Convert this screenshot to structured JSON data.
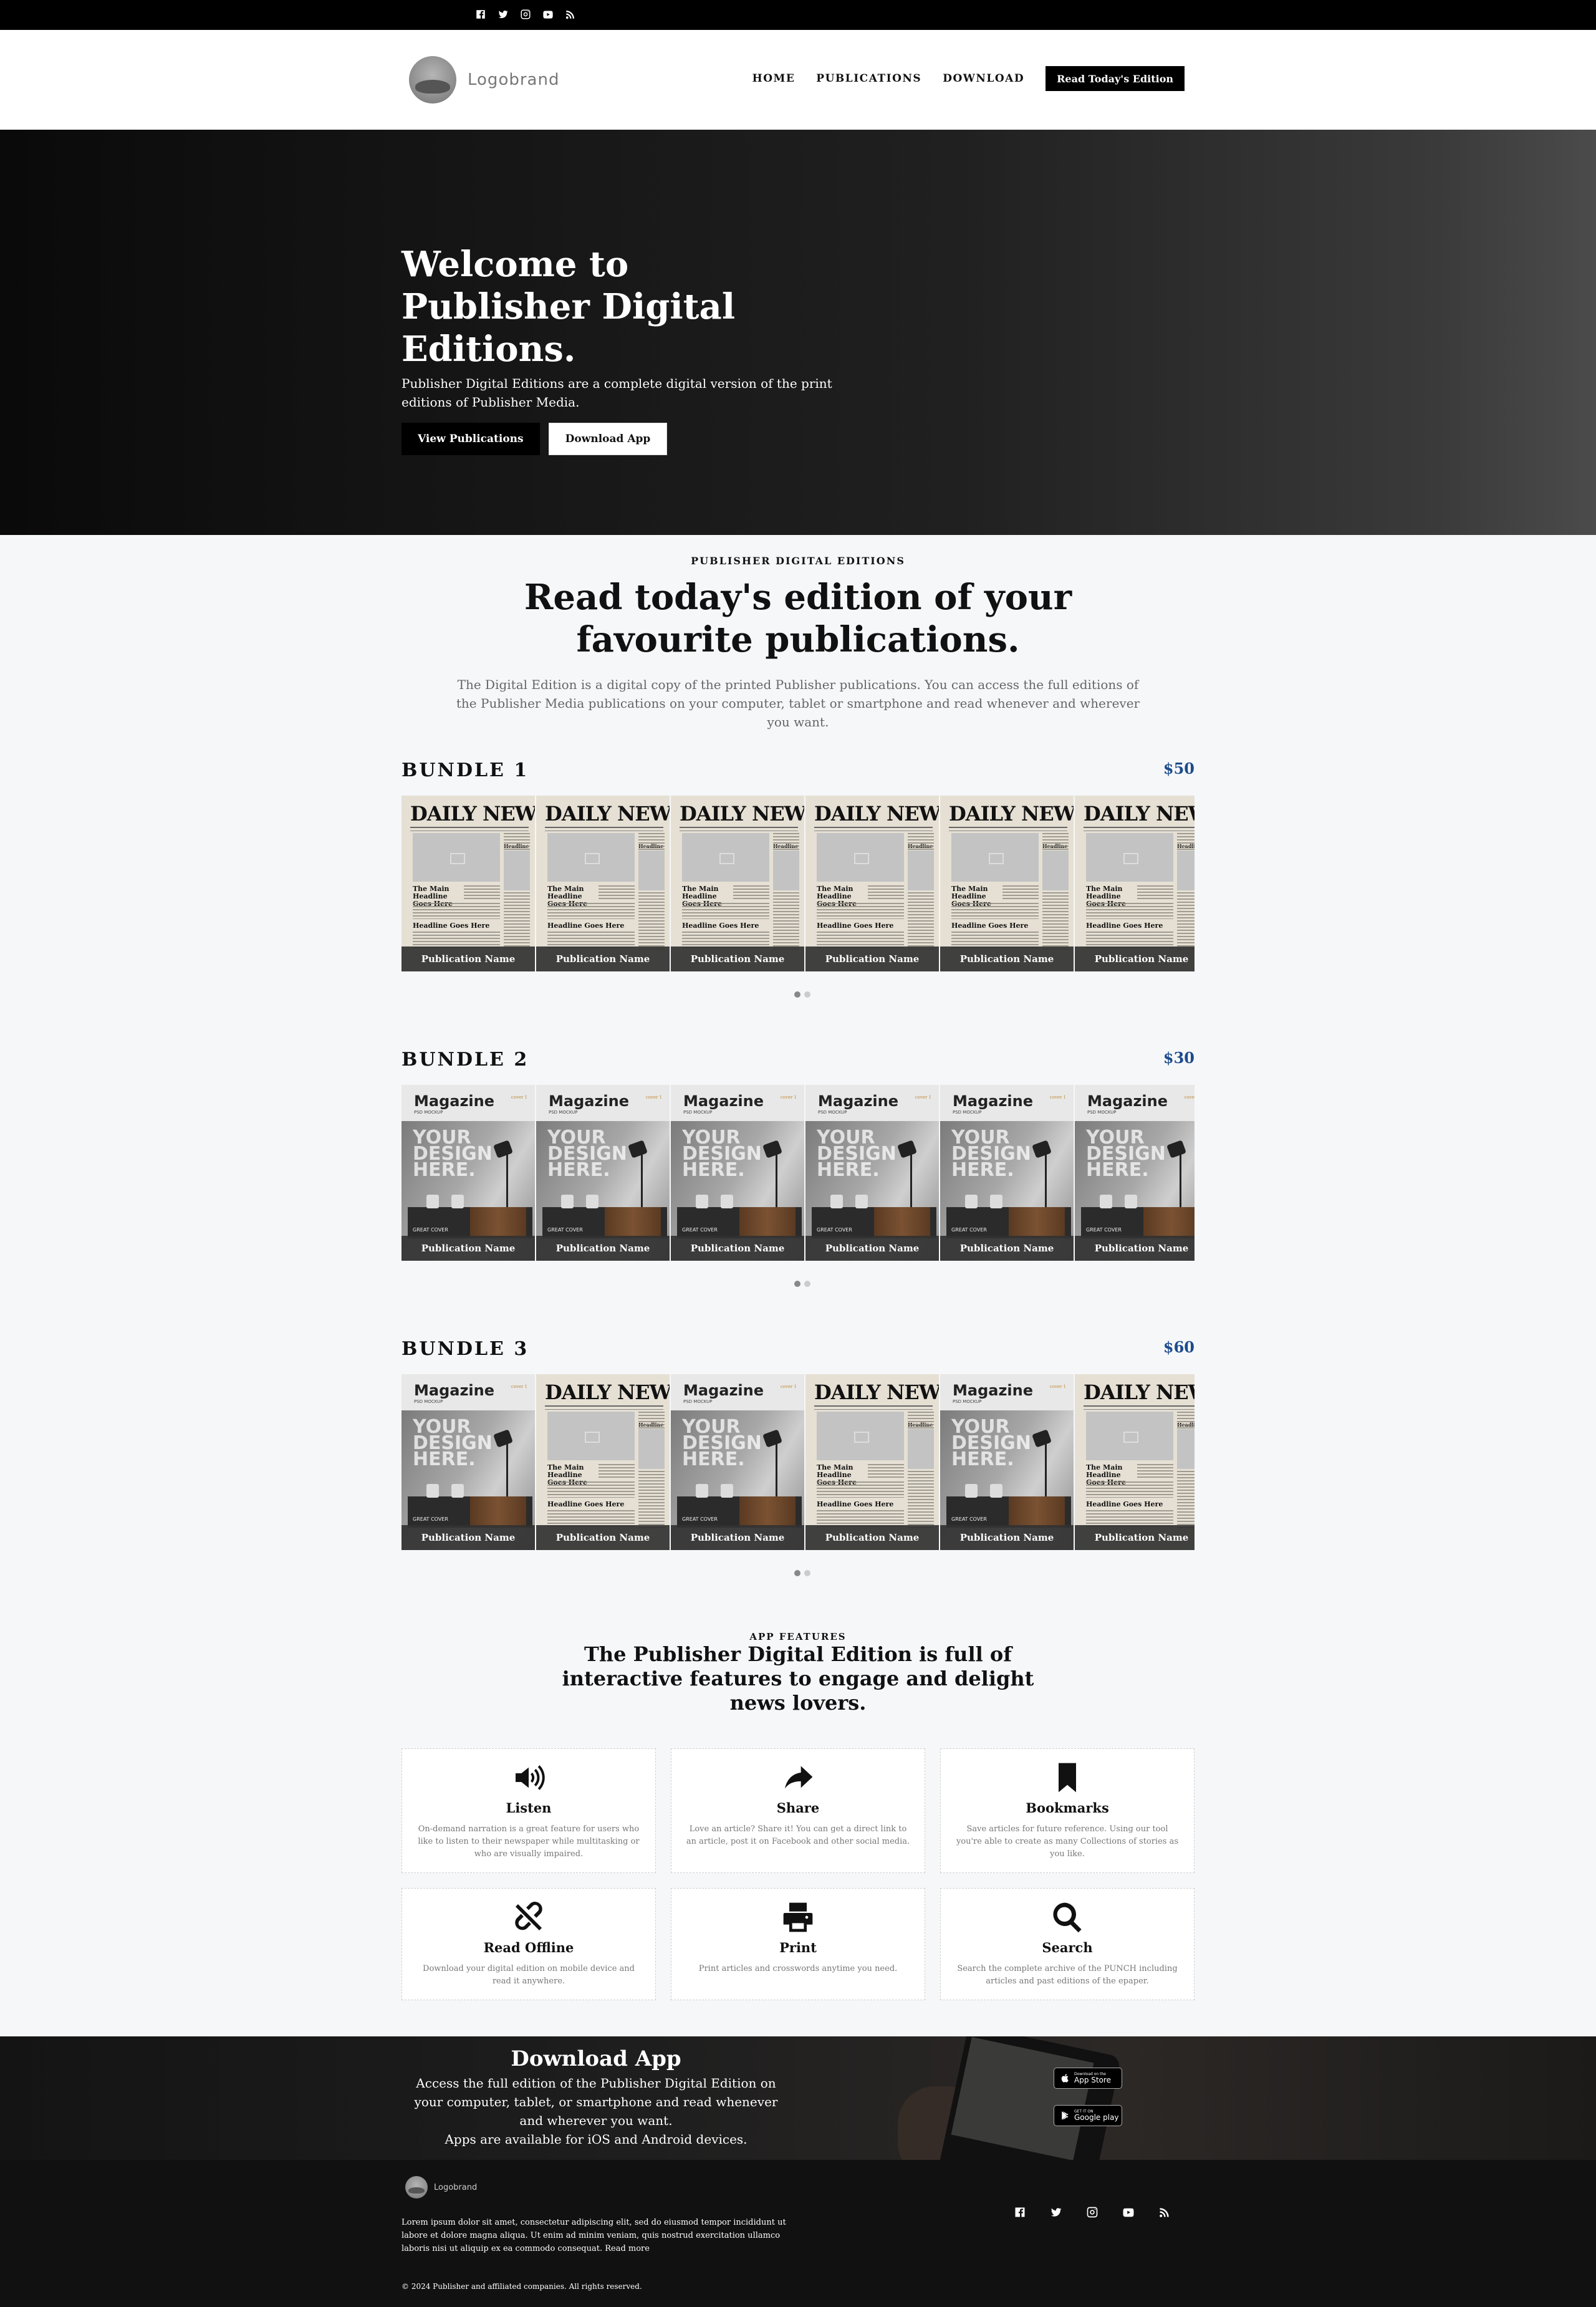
{
  "topbar": {
    "icons": [
      "facebook-icon",
      "twitter-icon",
      "instagram-icon",
      "youtube-icon",
      "rss-icon"
    ]
  },
  "header": {
    "logo_text": "Logobrand",
    "nav": [
      "HOME",
      "PUBLICATIONS",
      "DOWNLOAD"
    ],
    "cta": "Read Today's Edition"
  },
  "hero": {
    "title_line1": "Welcome to",
    "title_line2": "Publisher Digital Editions.",
    "description": "Publisher Digital Editions are a complete digital version of the print editions of Publisher Media.",
    "btn_primary": "View Publications",
    "btn_secondary": "Download App"
  },
  "intro": {
    "eyebrow": "PUBLISHER DIGITAL EDITIONS",
    "title": "Read today's edition of your favourite publications.",
    "description": "The Digital Edition is a digital copy of the printed Publisher publications. You can access the full editions of the Publisher Media publications on your computer, tablet or smartphone and read whenever and wherever you want."
  },
  "cover_text": {
    "news_masthead": "DAILY NEWS",
    "news_headline": "The Main Headline Goes Here",
    "news_headline2": "Headline Goes Here",
    "news_side_headline": "Headline Here",
    "mag_title": "Magazine",
    "mag_sub": "PSD MOCKUP",
    "mag_badge": "cover 1",
    "mag_big": "YOUR DESIGN HERE.",
    "mag_cover": "GREAT COVER"
  },
  "bundles": [
    {
      "name": "BUNDLE 1",
      "price": "$50",
      "items": [
        {
          "type": "news",
          "label": "Publication Name"
        },
        {
          "type": "news",
          "label": "Publication Name"
        },
        {
          "type": "news",
          "label": "Publication Name"
        },
        {
          "type": "news",
          "label": "Publication Name"
        },
        {
          "type": "news",
          "label": "Publication Name"
        },
        {
          "type": "news",
          "label": "Publication Name"
        }
      ]
    },
    {
      "name": "BUNDLE 2",
      "price": "$30",
      "items": [
        {
          "type": "mag",
          "label": "Publication Name"
        },
        {
          "type": "mag",
          "label": "Publication Name"
        },
        {
          "type": "mag",
          "label": "Publication Name"
        },
        {
          "type": "mag",
          "label": "Publication Name"
        },
        {
          "type": "mag",
          "label": "Publication Name"
        },
        {
          "type": "mag",
          "label": "Publication Name"
        }
      ]
    },
    {
      "name": "BUNDLE 3",
      "price": "$60",
      "items": [
        {
          "type": "mag",
          "label": "Publication Name"
        },
        {
          "type": "news",
          "label": "Publication Name"
        },
        {
          "type": "mag",
          "label": "Publication Name"
        },
        {
          "type": "news",
          "label": "Publication Name"
        },
        {
          "type": "mag",
          "label": "Publication Name"
        },
        {
          "type": "news",
          "label": "Publication Name"
        }
      ]
    }
  ],
  "features": {
    "eyebrow": "APP FEATURES",
    "title": "The Publisher Digital Edition is full of interactive features to engage and delight news lovers.",
    "items": [
      {
        "icon": "volume-icon",
        "title": "Listen",
        "text": "On-demand narration is a great feature for users who like to listen to their newspaper while multitasking or who are visually impaired."
      },
      {
        "icon": "share-icon",
        "title": "Share",
        "text": "Love an article? Share it! You can get a direct link to an article, post it on Facebook and other social media."
      },
      {
        "icon": "bookmark-icon",
        "title": "Bookmarks",
        "text": "Save articles for future reference. Using our tool you're able to create as many Collections of stories as you like."
      },
      {
        "icon": "unlink-icon",
        "title": "Read Offline",
        "text": "Download your digital edition on mobile device and read it anywhere."
      },
      {
        "icon": "print-icon",
        "title": "Print",
        "text": "Print articles and crosswords anytime you need."
      },
      {
        "icon": "search-icon",
        "title": "Search",
        "text": "Search the complete archive of the PUNCH including articles and past editions of the epaper."
      }
    ]
  },
  "download": {
    "title": "Download App",
    "text1": "Access the full edition of the Publisher Digital Edition on your computer, tablet, or smartphone and read whenever and wherever you want.",
    "text2": "Apps are available for iOS and Android devices.",
    "appstore_small": "Download on the",
    "appstore_big": "App Store",
    "googleplay_small": "GET IT ON",
    "googleplay_big": "Google play"
  },
  "footer": {
    "logo_text": "Logobrand",
    "text": "Lorem ipsum dolor sit amet, consectetur adipiscing elit, sed do eiusmod tempor incididunt ut labore et dolore magna aliqua. Ut enim ad minim veniam, quis nostrud exercitation ullamco laboris nisi ut aliquip ex ea commodo consequat. Read more",
    "copyright": "© 2024 Publisher and affiliated companies. All rights reserved.",
    "social": [
      "facebook-icon",
      "twitter-icon",
      "instagram-icon",
      "youtube-icon",
      "rss-icon"
    ]
  }
}
